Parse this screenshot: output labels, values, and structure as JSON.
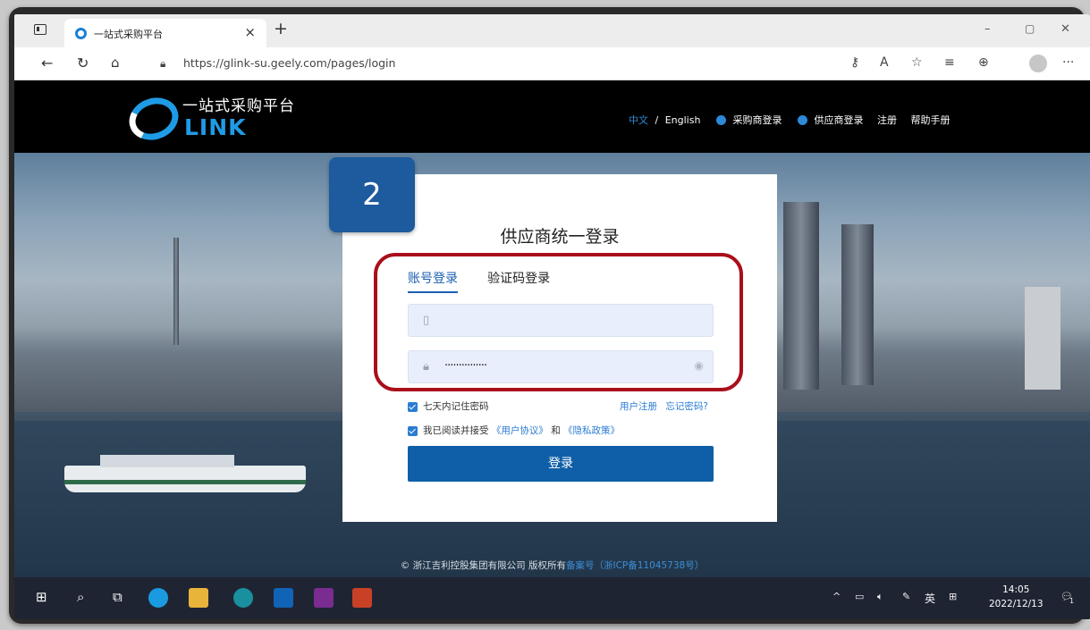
{
  "browser": {
    "tab_title": "一站式采购平台",
    "tab_close": "×",
    "new_tab": "+",
    "url": "https://glink-su.geely.com/pages/login",
    "minimize": "–",
    "maximize": "▢",
    "close": "✕",
    "more": "···"
  },
  "header": {
    "logo_cn": "一站式采购平台",
    "logo_en": "LINK",
    "lang_cn": "中文",
    "lang_sep": "/",
    "lang_en": "English",
    "buyer_login": "采购商登录",
    "supplier_login": "供应商登录",
    "register": "注册",
    "help": "帮助手册"
  },
  "login": {
    "title": "供应商统一登录",
    "tab_account": "账号登录",
    "tab_code": "验证码登录",
    "password_masked": "···············",
    "remember": "七天内记住密码",
    "user_register": "用户注册",
    "forgot": "忘记密码?",
    "agree_prefix": "我已阅读并接受",
    "user_agreement": "《用户协议》",
    "and": "和",
    "privacy": "《隐私政策》",
    "submit": "登录"
  },
  "badge": "2",
  "footer": {
    "copyright": "© 浙江吉利控股集团有限公司 版权所有",
    "icp_label": "备案号",
    "icp_number": "（浙ICP备11045738号）"
  },
  "taskbar": {
    "ime": "英",
    "time": "14:05",
    "date": "2022/12/13",
    "notifications": "1"
  },
  "colors": {
    "accent": "#1b5fb0",
    "button": "#0f5fa8",
    "highlight": "#a90f1b",
    "badge": "#1d5a9e"
  }
}
